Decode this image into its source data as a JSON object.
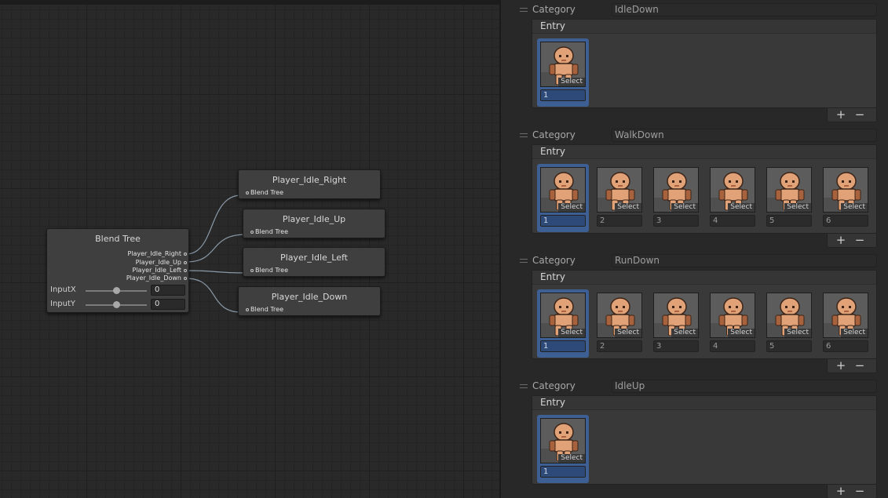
{
  "graph": {
    "blend_tree": {
      "title": "Blend Tree",
      "outputs": [
        "Player_Idle_Right",
        "Player_Idle_Up",
        "Player_Idle_Left",
        "Player_Idle_Down"
      ],
      "params": [
        {
          "name": "InputX",
          "value": "0",
          "slider": 0.5
        },
        {
          "name": "InputY",
          "value": "0",
          "slider": 0.5
        }
      ]
    },
    "clips": [
      {
        "title": "Player_Idle_Right",
        "port": "Blend Tree"
      },
      {
        "title": "Player_Idle_Up",
        "port": "Blend Tree"
      },
      {
        "title": "Player_Idle_Left",
        "port": "Blend Tree"
      },
      {
        "title": "Player_Idle_Down",
        "port": "Blend Tree"
      }
    ]
  },
  "inspector": {
    "category_label": "Category",
    "entry_label": "Entry",
    "select_label": "Select",
    "add_symbol": "+",
    "remove_symbol": "−",
    "categories": [
      {
        "name": "IdleDown",
        "entries": [
          "1"
        ]
      },
      {
        "name": "WalkDown",
        "entries": [
          "1",
          "2",
          "3",
          "4",
          "5",
          "6"
        ]
      },
      {
        "name": "RunDown",
        "entries": [
          "1",
          "2",
          "3",
          "4",
          "5",
          "6"
        ]
      },
      {
        "name": "IdleUp",
        "entries": [
          "1"
        ]
      }
    ]
  },
  "colors": {
    "selection": "#3d5f94",
    "skin": "#e2a277",
    "skin_shadow": "#a8623e",
    "outline": "#3a2418"
  }
}
